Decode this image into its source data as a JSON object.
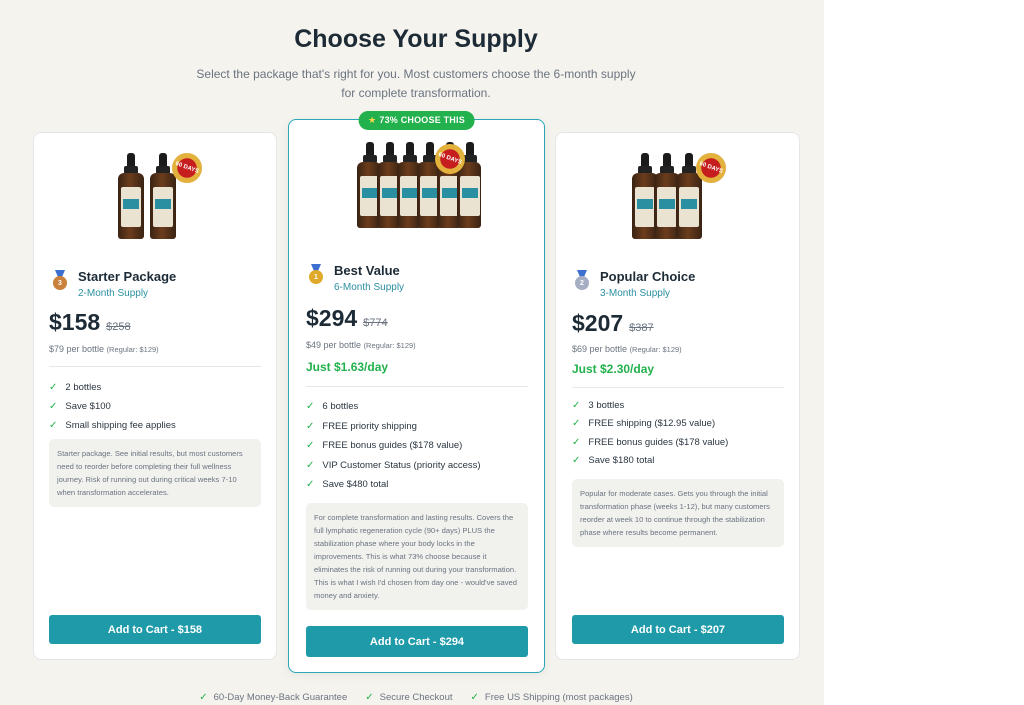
{
  "header": {
    "title": "Choose Your Supply",
    "subtitle": "Select the package that's right for you. Most customers choose the 6-month supply for complete transformation."
  },
  "product": {
    "brand_label": "LYMPH TONIC",
    "seal_text": "60 DAYS"
  },
  "plans": [
    {
      "name": "Starter Package",
      "supply": "2-Month Supply",
      "medal_number": "3",
      "medal_color": "#c9803a",
      "price": "$158",
      "old_price": "$258",
      "per_bottle": "$79 per bottle",
      "regular": "(Regular: $129)",
      "features": [
        "2 bottles",
        "Save $100",
        "Small shipping fee applies"
      ],
      "note": "Starter package. See initial results, but most customers need to reorder before completing their full wellness journey. Risk of running out during critical weeks 7-10 when transformation accelerates.",
      "button": "Add to Cart - $158"
    },
    {
      "name": "Best Value",
      "supply": "6-Month Supply",
      "badge": "73% CHOOSE THIS",
      "medal_number": "1",
      "medal_color": "#e0a92a",
      "price": "$294",
      "old_price": "$774",
      "per_bottle": "$49 per bottle",
      "regular": "(Regular: $129)",
      "per_day": "Just $1.63/day",
      "features": [
        "6 bottles",
        "FREE priority shipping",
        "FREE bonus guides ($178 value)",
        "VIP Customer Status (priority access)",
        "Save $480 total"
      ],
      "note": "For complete transformation and lasting results. Covers the full lymphatic regeneration cycle (90+ days) PLUS the stabilization phase where your body locks in the improvements. This is what 73% choose because it eliminates the risk of running out during your transformation. This is what I wish I'd chosen from day one - would've saved money and anxiety.",
      "button": "Add to Cart - $294"
    },
    {
      "name": "Popular Choice",
      "supply": "3-Month Supply",
      "medal_number": "2",
      "medal_color": "#a6aec4",
      "price": "$207",
      "old_price": "$387",
      "per_bottle": "$69 per bottle",
      "regular": "(Regular: $129)",
      "per_day": "Just $2.30/day",
      "features": [
        "3 bottles",
        "FREE shipping ($12.95 value)",
        "FREE bonus guides ($178 value)",
        "Save $180 total"
      ],
      "note": "Popular for moderate cases. Gets you through the initial transformation phase (weeks 1-12), but many customers reorder at week 10 to continue through the stabilization phase where results become permanent.",
      "button": "Add to Cart - $207"
    }
  ],
  "guarantees": [
    "60-Day Money-Back Guarantee",
    "Secure Checkout",
    "Free US Shipping (most packages)"
  ],
  "colors": {
    "accent": "#1e9aa9",
    "success": "#22b14c",
    "background": "#f5f3ee"
  },
  "icons": {
    "check": "check-icon",
    "star": "star-icon",
    "medal": "medal-icon"
  }
}
